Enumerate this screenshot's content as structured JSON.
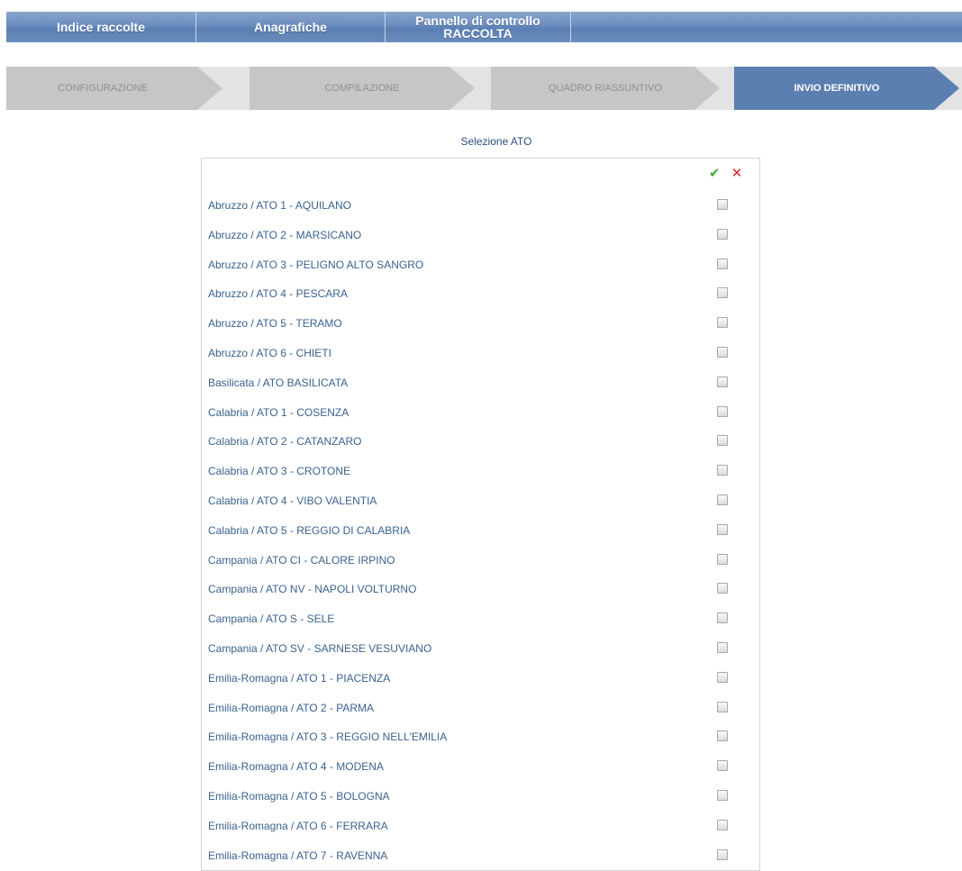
{
  "topnav": {
    "tab1": "Indice raccolte",
    "tab2": "Anagrafiche",
    "tab3_line1": "Pannello di controllo",
    "tab3_line2": "RACCOLTA"
  },
  "steps": {
    "s1": "CONFIGURAZIONE",
    "s2": "COMPILAZIONE",
    "s3": "QUADRO RIASSUNTIVO",
    "s4": "INVIO DEFINITIVO",
    "active": "INVIO DEFINITIVO"
  },
  "section": {
    "title": "Selezione ATO",
    "check_all_icon": "✔",
    "clear_all_icon": "✕"
  },
  "items": [
    "Abruzzo / ATO 1 - AQUILANO",
    "Abruzzo / ATO 2 - MARSICANO",
    "Abruzzo / ATO 3 - PELIGNO ALTO SANGRO",
    "Abruzzo / ATO 4 - PESCARA",
    "Abruzzo / ATO 5 - TERAMO",
    "Abruzzo / ATO 6 - CHIETI",
    "Basilicata / ATO BASILICATA",
    "Calabria / ATO 1 - COSENZA",
    "Calabria / ATO 2 - CATANZARO",
    "Calabria / ATO 3 - CROTONE",
    "Calabria / ATO 4 - VIBO VALENTIA",
    "Calabria / ATO 5 - REGGIO DI CALABRIA",
    "Campania / ATO CI - CALORE IRPINO",
    "Campania / ATO NV - NAPOLI VOLTURNO",
    "Campania / ATO S - SELE",
    "Campania / ATO SV - SARNESE VESUVIANO",
    "Emilia-Romagna / ATO 1 - PIACENZA",
    "Emilia-Romagna / ATO 2 - PARMA",
    "Emilia-Romagna / ATO 3 - REGGIO NELL'EMILIA",
    "Emilia-Romagna / ATO 4 - MODENA",
    "Emilia-Romagna / ATO 5 - BOLOGNA",
    "Emilia-Romagna / ATO 6 - FERRARA",
    "Emilia-Romagna / ATO 7 - RAVENNA"
  ]
}
